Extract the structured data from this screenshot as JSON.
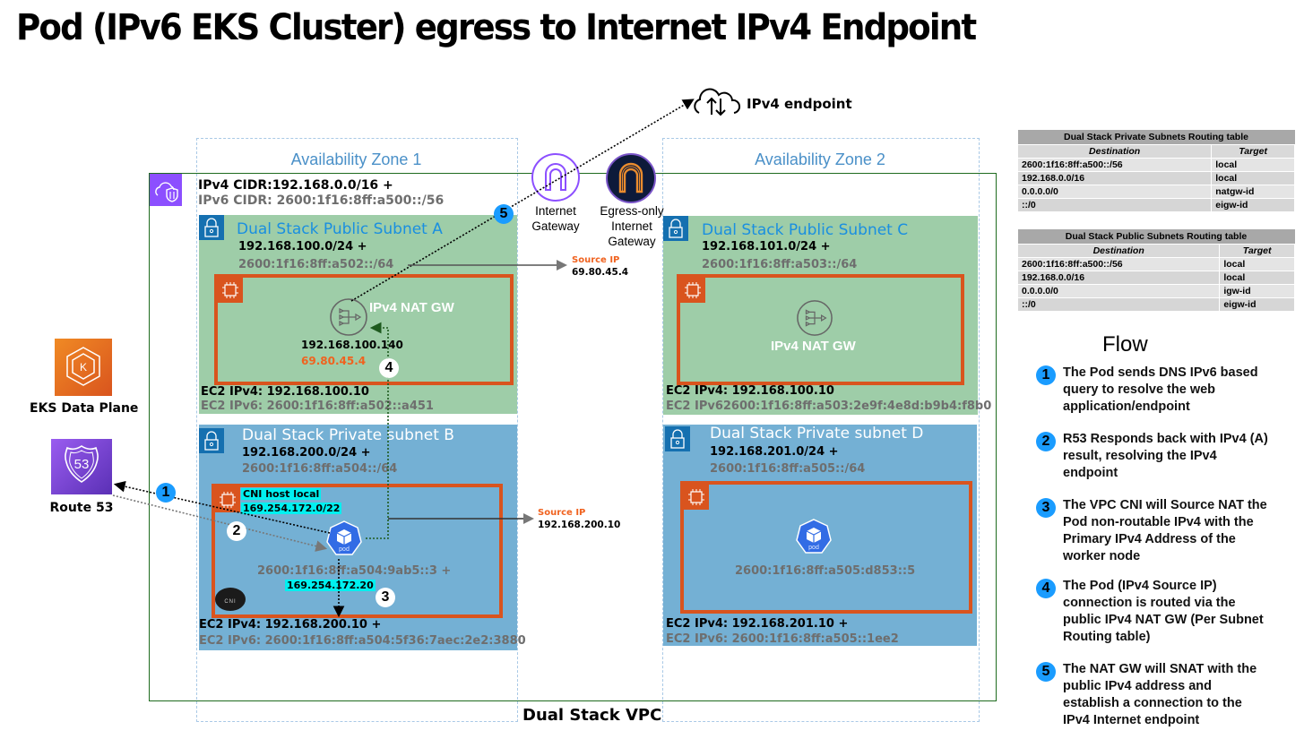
{
  "title": "Pod (IPv6 EKS Cluster) egress to Internet IPv4 Endpoint",
  "colors": {
    "public_subnet": "#9ecda8",
    "private_subnet": "#74b0d4",
    "ec2_border": "#d9541e",
    "vpc_border": "#1e6b1e",
    "badge_blue": "#1a9cff",
    "highlight_cyan": "#00f0f0",
    "source_ip_orange": "#f0621f"
  },
  "internet": {
    "endpoint_icon": "cloud-upload-download-icon",
    "endpoint_label": "IPv4 endpoint"
  },
  "gateways": {
    "igw_label_line1": "Internet",
    "igw_label_line2": "Gateway",
    "eigw_label_line1": "Egress-only",
    "eigw_label_line2": "Internet",
    "eigw_label_line3": "Gateway"
  },
  "vpc": {
    "label": "Dual Stack VPC",
    "ipv4_cidr": "IPv4 CIDR:192.168.0.0/16 +",
    "ipv6_cidr": "IPv6 CIDR: 2600:1f16:8ff:a500::/56"
  },
  "zones": [
    {
      "label": "Availability Zone 1"
    },
    {
      "label": "Availability Zone 2"
    }
  ],
  "subnets": {
    "a": {
      "title": "Dual Stack Public Subnet A",
      "ipv4": "192.168.100.0/24 +",
      "ipv6": "2600:1f16:8ff:a502::/64",
      "nat_label": "IPv4 NAT GW",
      "nat_private_ip": "192.168.100.140",
      "nat_public_ip": "69.80.45.4",
      "ec2_ipv4": "EC2 IPv4: 192.168.100.10",
      "ec2_ipv6": "EC2 IPv6: 2600:1f16:8ff:a502::a451"
    },
    "b": {
      "title": "Dual Stack Private subnet B",
      "ipv4": "192.168.200.0/24 +",
      "ipv6": "2600:1f16:8ff:a504::/64",
      "cni_host_local_label": "CNI host local",
      "cni_host_local_cidr": "169.254.172.0/22",
      "pod_label": "pod",
      "pod_ipv6": "2600:1f16:8ff:a504:9ab5::3 +",
      "pod_ipv4": "169.254.172.20",
      "cni_label": "CNI",
      "ec2_ipv4": "EC2 IPv4: 192.168.200.10 +",
      "ec2_ipv6": "EC2 IPv6: 2600:1f16:8ff:a504:5f36:7aec:2e2:3880"
    },
    "c": {
      "title": "Dual Stack Public Subnet C",
      "ipv4": "192.168.101.0/24 +",
      "ipv6": "2600:1f16:8ff:a503::/64",
      "nat_label": "IPv4 NAT GW",
      "ec2_ipv4": "EC2 IPv4: 192.168.100.10",
      "ec2_ipv6": "EC2 IPv62600:1f16:8ff:a503:2e9f:4e8d:b9b4:f8b0"
    },
    "d": {
      "title": "Dual Stack Private subnet D",
      "ipv4": "192.168.201.0/24 +",
      "ipv6": "2600:1f16:8ff:a505::/64",
      "pod_label": "pod",
      "pod_ipv6": "2600:1f16:8ff:a505:d853::5",
      "ec2_ipv4": "EC2 IPv4: 192.168.201.10 +",
      "ec2_ipv6": "EC2 IPv6: 2600:1f16:8ff:a505::1ee2"
    }
  },
  "source_ips": [
    {
      "label": "Source IP",
      "value": "69.80.45.4"
    },
    {
      "label": "Source IP",
      "value": "192.168.200.10"
    }
  ],
  "services": {
    "eks_label": "EKS Data Plane",
    "route53_label": "Route 53",
    "route53_icon_text": "53"
  },
  "badges": [
    "1",
    "2",
    "3",
    "4",
    "5"
  ],
  "routing_tables": [
    {
      "caption": "Dual Stack Private Subnets Routing table",
      "headers": [
        "Destination",
        "Target"
      ],
      "rows": [
        [
          "2600:1f16:8ff:a500::/56",
          "local"
        ],
        [
          "192.168.0.0/16",
          "local"
        ],
        [
          "0.0.0.0/0",
          "natgw-id"
        ],
        [
          "::/0",
          "eigw-id"
        ]
      ]
    },
    {
      "caption": "Dual Stack Public Subnets Routing table",
      "headers": [
        "Destination",
        "Target"
      ],
      "rows": [
        [
          "2600:1f16:8ff:a500::/56",
          "local"
        ],
        [
          "192.168.0.0/16",
          "local"
        ],
        [
          "0.0.0.0/0",
          "igw-id"
        ],
        [
          "::/0",
          "eigw-id"
        ]
      ]
    }
  ],
  "flow": {
    "title": "Flow",
    "steps": [
      {
        "n": "1",
        "text": "The Pod sends DNS IPv6 based query to resolve the web application/endpoint"
      },
      {
        "n": "2",
        "text": "R53 Responds back with IPv4 (A) result, resolving the IPv4 endpoint"
      },
      {
        "n": "3",
        "text": "The VPC CNI will Source NAT the Pod non-routable IPv4 with the Primary IPv4 Address of the worker node"
      },
      {
        "n": "4",
        "text": "The Pod (IPv4 Source IP) connection is routed via the public IPv4 NAT GW (Per Subnet Routing table)"
      },
      {
        "n": "5",
        "text": "The NAT GW will SNAT with the public IPv4 address and establish a connection to the IPv4 Internet endpoint"
      }
    ]
  }
}
